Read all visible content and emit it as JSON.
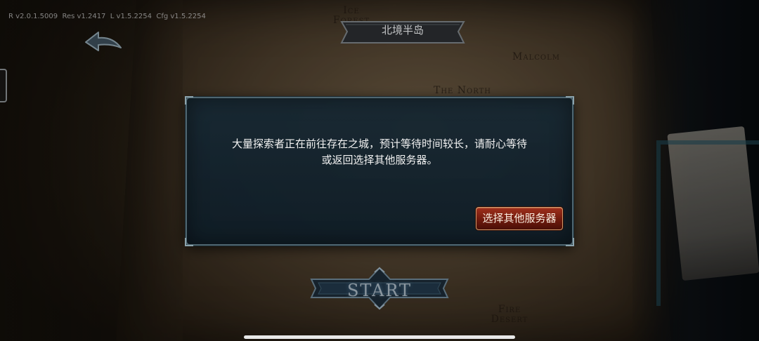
{
  "version_info": "R v2.0.1.5009  Res v1.2417  L v1.5.2254  Cfg v1.5.2254",
  "region": {
    "title": "北境半岛"
  },
  "map_labels": {
    "ice_forest_line1": "Ice",
    "ice_forest_line2": "Forest",
    "malcolm": "Malcolm",
    "the_north": "The North",
    "fire_desert_line1": "Fire",
    "fire_desert_line2": "Desert"
  },
  "dialog": {
    "message_line1": "大量探索者正在前往存在之城，预计等待时间较长，请耐心等待",
    "message_line2": "或返回选择其他服务器。",
    "button_label": "选择其他服务器"
  },
  "start_button": {
    "label": "START"
  },
  "icons": {
    "back": "back-arrow-icon",
    "side_tab": "side-tab-icon"
  },
  "colors": {
    "dialog_bg": "#16283a",
    "dialog_border": "#4f6670",
    "button_red": "#a0301c",
    "start_text": "#a9b8c2"
  }
}
